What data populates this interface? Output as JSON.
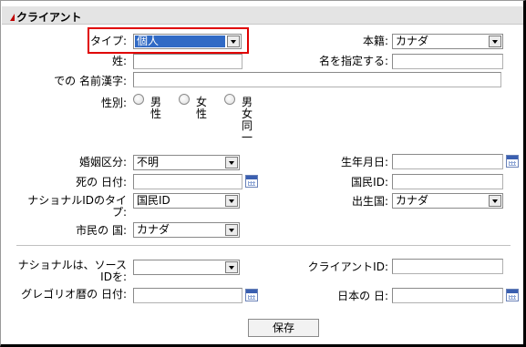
{
  "section": {
    "title": "クライアント"
  },
  "fields": {
    "type": {
      "label": "タイプ:",
      "value": "個人"
    },
    "citizenship": {
      "label": "本籍:",
      "value": "カナダ"
    },
    "surname": {
      "label": "姓:",
      "value": ""
    },
    "given_names": {
      "label": "名を指定する:",
      "value": ""
    },
    "kanji_name": {
      "label": "での 名前漢字:",
      "value": ""
    },
    "gender": {
      "label": "性別:",
      "options": [
        {
          "label": "男性"
        },
        {
          "label": "女性"
        },
        {
          "label": "男女同一"
        }
      ]
    },
    "marital": {
      "label": "婚姻区分:",
      "value": "不明"
    },
    "birth_date": {
      "label": "生年月日:",
      "value": ""
    },
    "death_date": {
      "label": "死の 日付:",
      "value": ""
    },
    "national_id": {
      "label": "国民ID:",
      "value": ""
    },
    "national_id_type": {
      "label": "ナショナルIDのタイプ:",
      "value": "国民ID"
    },
    "country_of_birth": {
      "label": "出生国:",
      "value": "カナダ"
    },
    "country_of_citizenship": {
      "label": "市民の 国:",
      "value": "カナダ"
    },
    "national_id_source": {
      "label": "ナショナルは、ソースIDを:",
      "value": ""
    },
    "client_id": {
      "label": "クライアントID:",
      "value": ""
    },
    "gregorian_date": {
      "label": "グレゴリオ暦の 日付:",
      "value": ""
    },
    "japanese_date": {
      "label": "日本の 日:",
      "value": ""
    }
  },
  "buttons": {
    "save": "保存"
  }
}
